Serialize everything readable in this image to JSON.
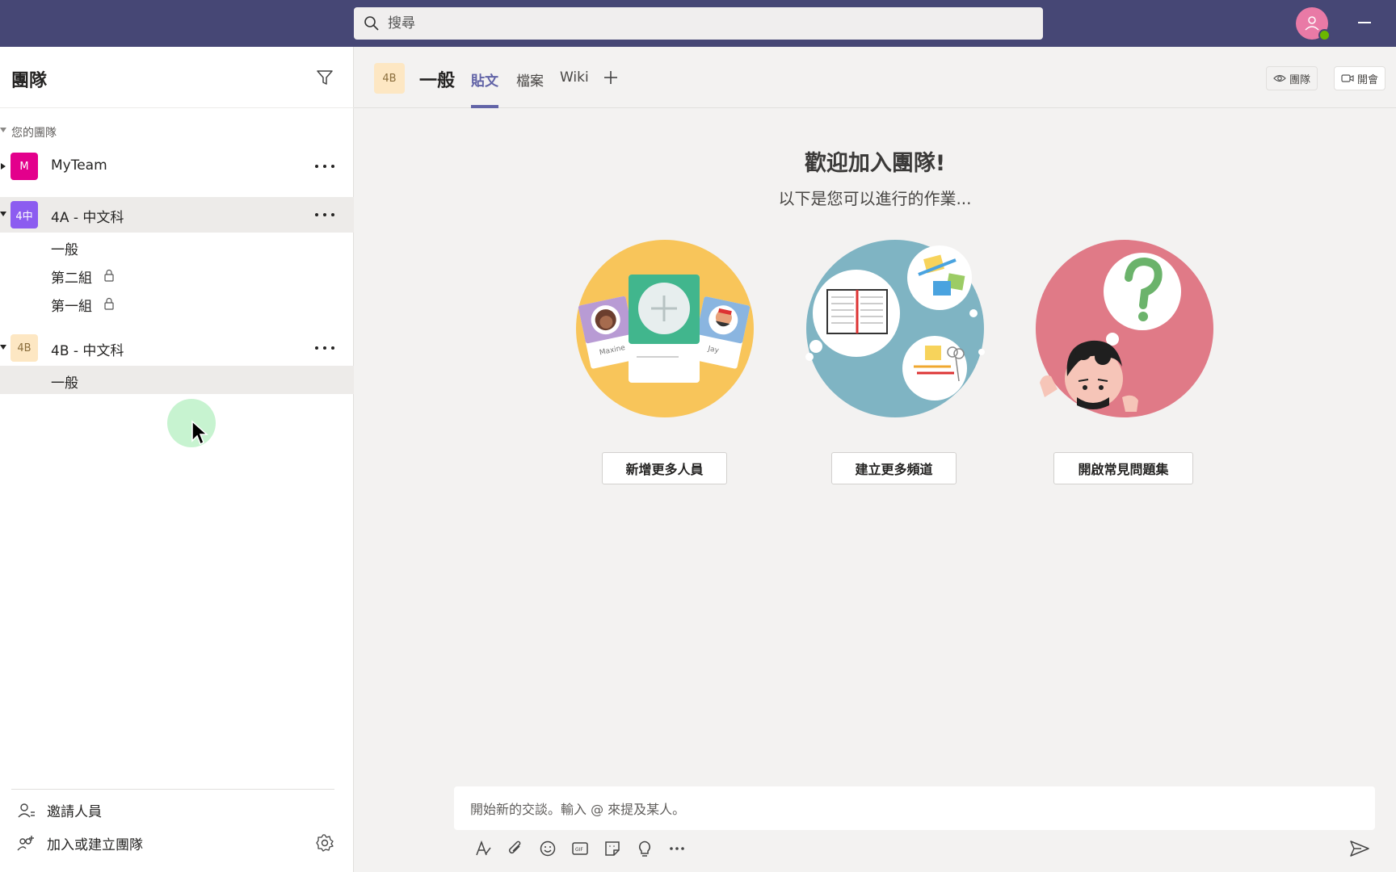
{
  "topbar": {
    "search_placeholder": "搜尋",
    "icons": [
      "search-icon",
      "avatar-icon",
      "minimize-icon"
    ]
  },
  "sidebar": {
    "title": "團隊",
    "section_label": "您的團隊",
    "teams": [
      {
        "tile": "M",
        "name": "MyTeam",
        "tile_color": "#e3008c"
      },
      {
        "tile": "4中",
        "name": "4A - 中文科",
        "tile_color": "#8c5cf0",
        "channels": [
          {
            "name": "一般",
            "locked": false
          },
          {
            "name": "第二組",
            "locked": true
          },
          {
            "name": "第一組",
            "locked": true
          }
        ]
      },
      {
        "tile": "4B",
        "name": "4B - 中文科",
        "tile_color": "#fde7c3",
        "channels": [
          {
            "name": "一般",
            "locked": false
          }
        ]
      }
    ],
    "footer": {
      "invite": "邀請人員",
      "join_create": "加入或建立團隊"
    }
  },
  "main": {
    "channel_tile": "4B",
    "channel_title": "一般",
    "tabs": [
      "貼文",
      "檔案",
      "Wiki"
    ],
    "active_tab": "貼文",
    "header_buttons": {
      "team": "團隊",
      "meet": "開會"
    },
    "welcome_title": "歡迎加入團隊!",
    "welcome_sub": "以下是您可以進行的作業...",
    "cards": [
      {
        "button": "新增更多人員"
      },
      {
        "button": "建立更多頻道"
      },
      {
        "button": "開啟常見問題集"
      }
    ],
    "illustration_labels": {
      "maxine": "Maxine",
      "jay": "Jay"
    },
    "compose_placeholder": "開始新的交談。輸入 @ 來提及某人。"
  },
  "colors": {
    "topbar": "#464775",
    "accent": "#6264a7",
    "presence": "#6bb700"
  }
}
